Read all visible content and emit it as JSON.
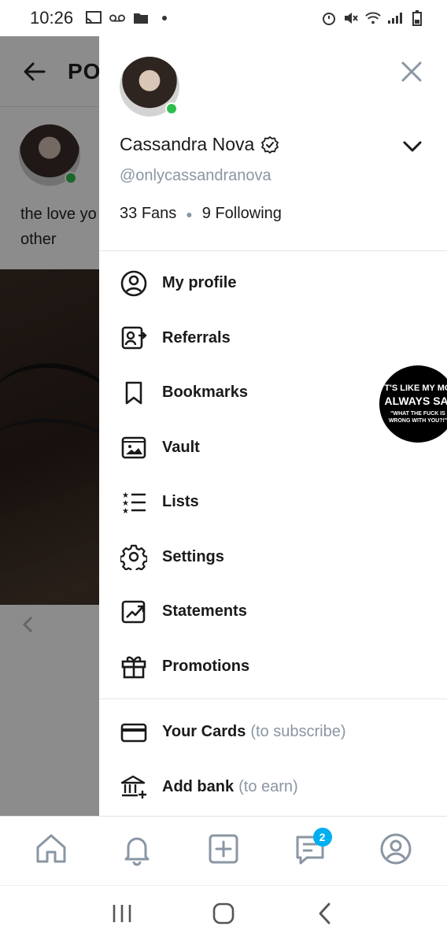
{
  "status_bar": {
    "time": "10:26"
  },
  "background_page": {
    "title": "PO",
    "post_text": "the love yo other"
  },
  "drawer": {
    "user": {
      "name": "Cassandra Nova",
      "handle": "@onlycassandranova",
      "fans_count": "33",
      "fans_label": "Fans",
      "following_count": "9",
      "following_label": "Following"
    },
    "menu_primary": [
      {
        "label": "My profile",
        "icon": "profile-icon"
      },
      {
        "label": "Referrals",
        "icon": "referrals-icon"
      },
      {
        "label": "Bookmarks",
        "icon": "bookmark-icon"
      },
      {
        "label": "Vault",
        "icon": "vault-icon"
      },
      {
        "label": "Lists",
        "icon": "lists-icon"
      },
      {
        "label": "Settings",
        "icon": "gear-icon"
      },
      {
        "label": "Statements",
        "icon": "statements-icon"
      },
      {
        "label": "Promotions",
        "icon": "gift-icon"
      }
    ],
    "menu_secondary": [
      {
        "label": "Your Cards",
        "sub": "(to subscribe)",
        "icon": "card-icon"
      },
      {
        "label": "Add bank",
        "sub": "(to earn)",
        "icon": "bank-icon"
      }
    ]
  },
  "sticker": {
    "line1": "T'S LIKE MY MO",
    "line2": "ALWAYS SAI",
    "line3a": "\"WHAT THE FUCK IS",
    "line3b": "WRONG WITH YOU?!\""
  },
  "tabbar": {
    "tabs": [
      {
        "name": "home",
        "icon": "home-icon"
      },
      {
        "name": "notifications",
        "icon": "bell-icon"
      },
      {
        "name": "new-post",
        "icon": "add-post-icon"
      },
      {
        "name": "messages",
        "icon": "messages-icon"
      },
      {
        "name": "profile",
        "icon": "profile-icon"
      }
    ],
    "messages_badge": "2"
  },
  "colors": {
    "accent": "#00aff0",
    "online": "#2fbe4e",
    "muted_text": "#8a96a3",
    "icon": "#1a1a1a"
  }
}
